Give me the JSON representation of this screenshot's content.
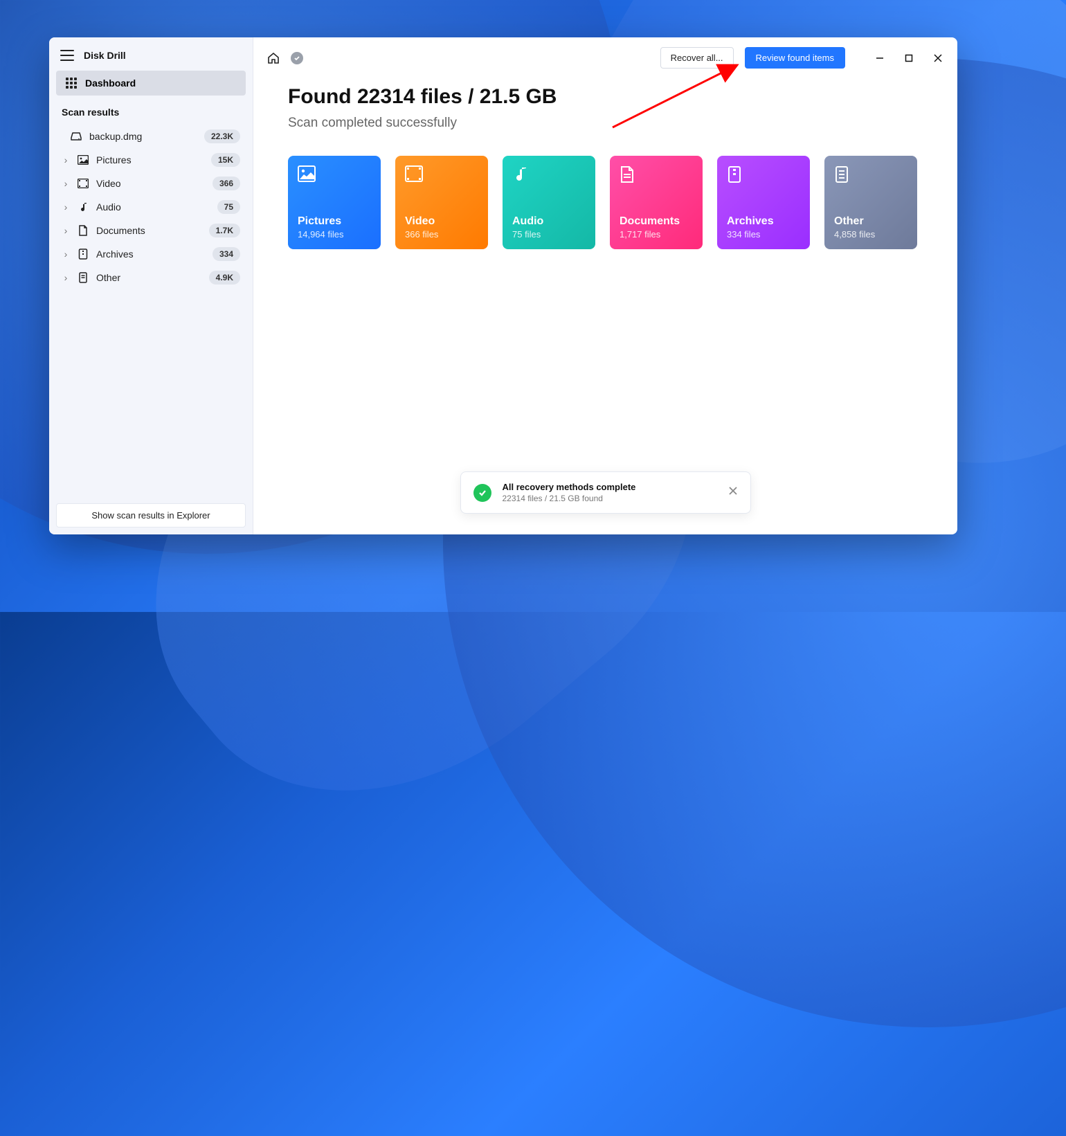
{
  "app_title": "Disk Drill",
  "sidebar": {
    "dashboard": "Dashboard",
    "section_label": "Scan results",
    "device": {
      "label": "backup.dmg",
      "count": "22.3K"
    },
    "items": [
      {
        "label": "Pictures",
        "count": "15K"
      },
      {
        "label": "Video",
        "count": "366"
      },
      {
        "label": "Audio",
        "count": "75"
      },
      {
        "label": "Documents",
        "count": "1.7K"
      },
      {
        "label": "Archives",
        "count": "334"
      },
      {
        "label": "Other",
        "count": "4.9K"
      }
    ],
    "footer_button": "Show scan results in Explorer"
  },
  "topbar": {
    "recover_all": "Recover all...",
    "review_button": "Review found items"
  },
  "main": {
    "heading": "Found 22314 files / 21.5 GB",
    "subheading": "Scan completed successfully",
    "cards": [
      {
        "title": "Pictures",
        "sub": "14,964 files"
      },
      {
        "title": "Video",
        "sub": "366 files"
      },
      {
        "title": "Audio",
        "sub": "75 files"
      },
      {
        "title": "Documents",
        "sub": "1,717 files"
      },
      {
        "title": "Archives",
        "sub": "334 files"
      },
      {
        "title": "Other",
        "sub": "4,858 files"
      }
    ]
  },
  "toast": {
    "title": "All recovery methods complete",
    "sub": "22314 files / 21.5 GB found"
  }
}
